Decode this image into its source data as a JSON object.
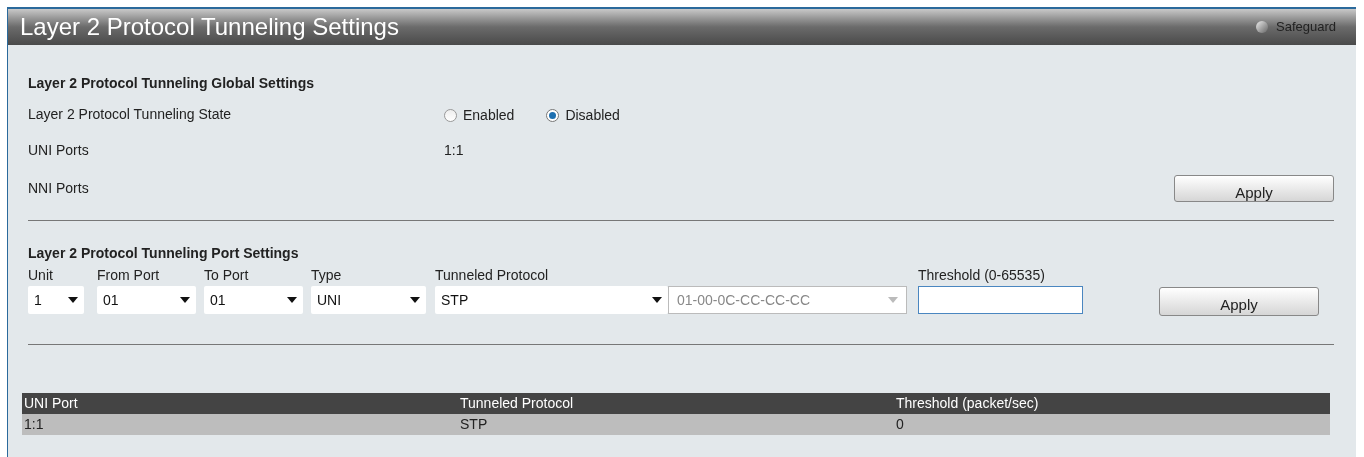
{
  "window": {
    "title": "Layer 2 Protocol Tunneling Settings",
    "safeguard": "Safeguard"
  },
  "global_settings": {
    "heading": "Layer 2 Protocol Tunneling Global Settings",
    "state": {
      "label": "Layer 2 Protocol Tunneling State",
      "options": [
        {
          "label": "Enabled",
          "selected": false
        },
        {
          "label": "Disabled",
          "selected": true
        }
      ]
    },
    "uni_ports": {
      "label": "UNI Ports",
      "value": "1:1"
    },
    "nni_ports": {
      "label": "NNI Ports"
    },
    "apply": "Apply"
  },
  "port_settings": {
    "heading": "Layer 2 Protocol Tunneling Port Settings",
    "fields": [
      {
        "kind": "select",
        "label": "Unit",
        "value": "1",
        "disabled": false
      },
      {
        "kind": "select",
        "label": "From Port",
        "value": "01",
        "disabled": false
      },
      {
        "kind": "select",
        "label": "To Port",
        "value": "01",
        "disabled": false
      },
      {
        "kind": "select",
        "label": "Type",
        "value": "UNI",
        "disabled": false
      },
      {
        "kind": "select",
        "label": "Tunneled Protocol",
        "value": "STP",
        "disabled": false
      },
      {
        "kind": "select",
        "value": "01-00-0C-CC-CC-CC",
        "disabled": true
      },
      {
        "kind": "input",
        "label": "Threshold (0-65535)"
      }
    ],
    "apply": "Apply"
  },
  "table": {
    "columns": [
      "UNI Port",
      "Tunneled Protocol",
      "Threshold (packet/sec)"
    ],
    "rows": [
      [
        "1:1",
        "STP",
        "0"
      ]
    ]
  }
}
